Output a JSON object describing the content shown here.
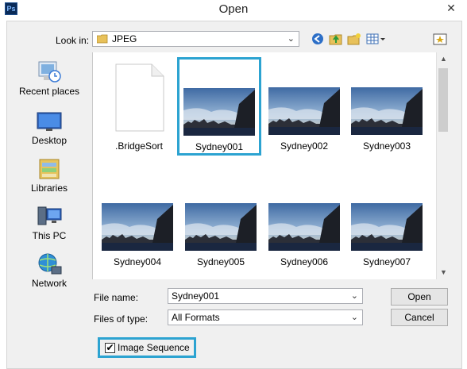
{
  "window": {
    "title": "Open",
    "close_glyph": "✕",
    "app_icon_text": "Ps"
  },
  "lookin": {
    "label": "Look in:",
    "value": "JPEG"
  },
  "places": [
    {
      "label": "Recent places",
      "icon": "recent-places-icon"
    },
    {
      "label": "Desktop",
      "icon": "desktop-icon"
    },
    {
      "label": "Libraries",
      "icon": "libraries-icon"
    },
    {
      "label": "This PC",
      "icon": "this-pc-icon"
    },
    {
      "label": "Network",
      "icon": "network-icon"
    }
  ],
  "files": [
    {
      "name": ".BridgeSort",
      "kind": "document"
    },
    {
      "name": "Sydney001",
      "kind": "image",
      "selected": true
    },
    {
      "name": "Sydney002",
      "kind": "image"
    },
    {
      "name": "Sydney003",
      "kind": "image"
    },
    {
      "name": "Sydney004",
      "kind": "image"
    },
    {
      "name": "Sydney005",
      "kind": "image"
    },
    {
      "name": "Sydney006",
      "kind": "image"
    },
    {
      "name": "Sydney007",
      "kind": "image"
    }
  ],
  "filename": {
    "label": "File name:",
    "value": "Sydney001"
  },
  "filetype": {
    "label": "Files of type:",
    "value": "All Formats"
  },
  "buttons": {
    "open": "Open",
    "cancel": "Cancel"
  },
  "sequence": {
    "label": "Image Sequence",
    "checked": true,
    "check_glyph": "✔"
  },
  "colors": {
    "highlight": "#2ca3d1",
    "dialog_bg": "#f0f0f0"
  }
}
